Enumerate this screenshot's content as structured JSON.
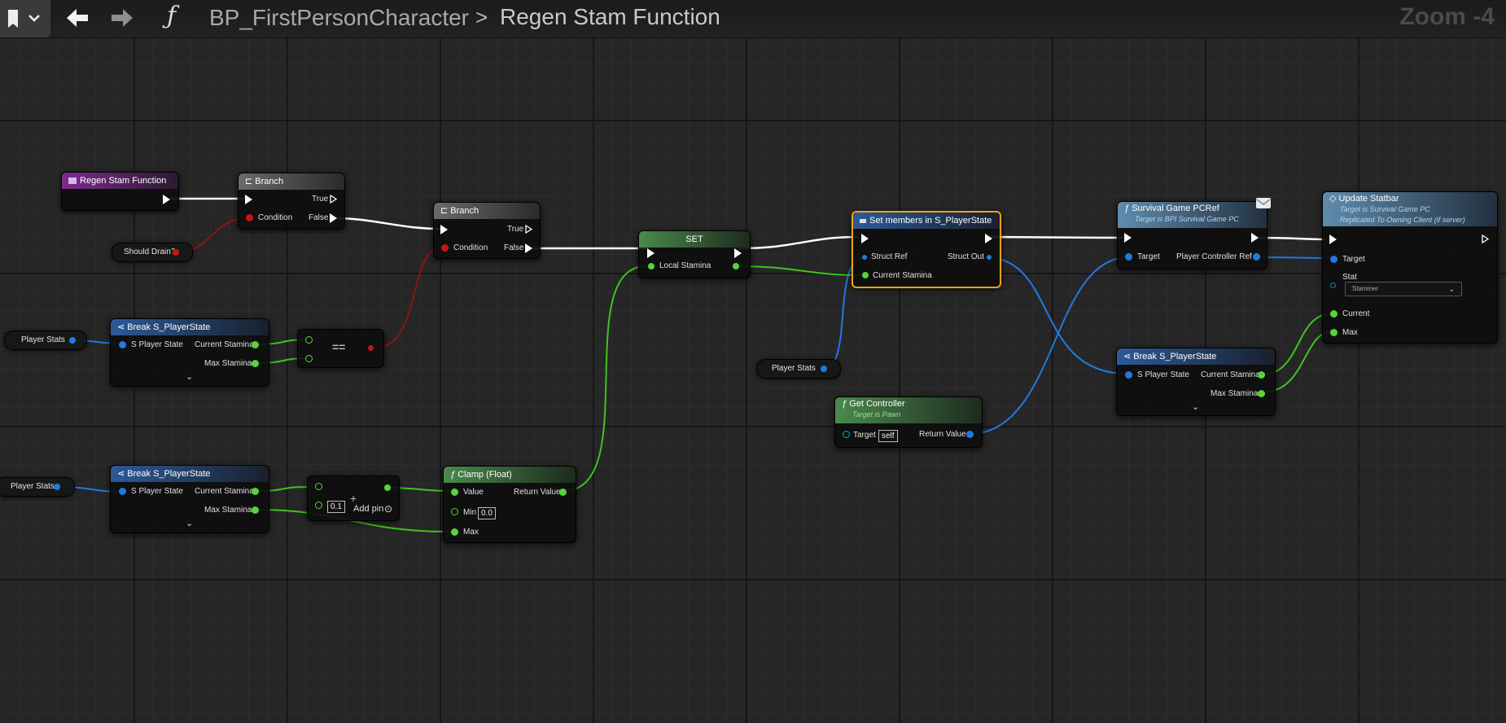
{
  "header": {
    "breadcrumb_root": "BP_FirstPersonCharacter",
    "breadcrumb_separator": ">",
    "breadcrumb_current": "Regen Stam Function",
    "zoom_label": "Zoom -4",
    "function_glyph": "ƒ",
    "back_glyph": "🡄",
    "forward_glyph": "🡆"
  },
  "nodes": {
    "entry": {
      "title": "Regen Stam Function"
    },
    "branch1": {
      "title": "Branch",
      "true_label": "True",
      "false_label": "False",
      "condition_label": "Condition"
    },
    "branch2": {
      "title": "Branch",
      "true_label": "True",
      "false_label": "False",
      "condition_label": "Condition"
    },
    "should_drain": {
      "label": "Should Drain?"
    },
    "player_stats_1": {
      "label": "Player Stats"
    },
    "player_stats_2": {
      "label": "Player Stats"
    },
    "player_stats_3": {
      "label": "Player Stats"
    },
    "break1": {
      "title": "Break S_PlayerState",
      "in_label": "S Player State",
      "out1": "Current Stamina",
      "out2": "Max Stamina"
    },
    "break2": {
      "title": "Break S_PlayerState",
      "in_label": "S Player State",
      "out1": "Current Stamina",
      "out2": "Max Stamina"
    },
    "break3": {
      "title": "Break S_PlayerState",
      "in_label": "S Player State",
      "out1": "Current Stamina",
      "out2": "Max Stamina"
    },
    "equals": {
      "symbol": "=="
    },
    "add": {
      "symbol": "+",
      "value": "0.1",
      "add_pin_label": "Add pin"
    },
    "clamp": {
      "title": "Clamp (Float)",
      "value_label": "Value",
      "min_label": "Min",
      "min_value": "0.0",
      "max_label": "Max",
      "return_label": "Return Value"
    },
    "set": {
      "title": "SET",
      "var_label": "Local Stamina"
    },
    "set_members": {
      "title": "Set members in S_PlayerState",
      "struct_ref": "Struct Ref",
      "struct_out": "Struct Out",
      "current_stamina": "Current Stamina"
    },
    "get_controller": {
      "title": "Get Controller",
      "subtitle": "Target is Pawn",
      "target_label": "Target",
      "target_value": "self",
      "return_label": "Return Value"
    },
    "survival_pcref": {
      "title": "Survival Game PCRef",
      "subtitle": "Target is BPI Survival Game PC",
      "target_label": "Target",
      "out_label": "Player Controller Ref"
    },
    "update_statbar": {
      "title": "Update Statbar",
      "subtitle1": "Target is Survival Game PC",
      "subtitle2": "Replicated To Owning Client (if server)",
      "target_label": "Target",
      "stat_label": "Stat",
      "stat_value": "Staminer",
      "current_label": "Current",
      "max_label": "Max"
    }
  },
  "colors": {
    "exec_wire": "#ffffff",
    "bool_wire": "#8c1414",
    "float_wire": "#3dc41f",
    "struct_wire": "#1f7be0",
    "selection": "#f3a21c"
  }
}
